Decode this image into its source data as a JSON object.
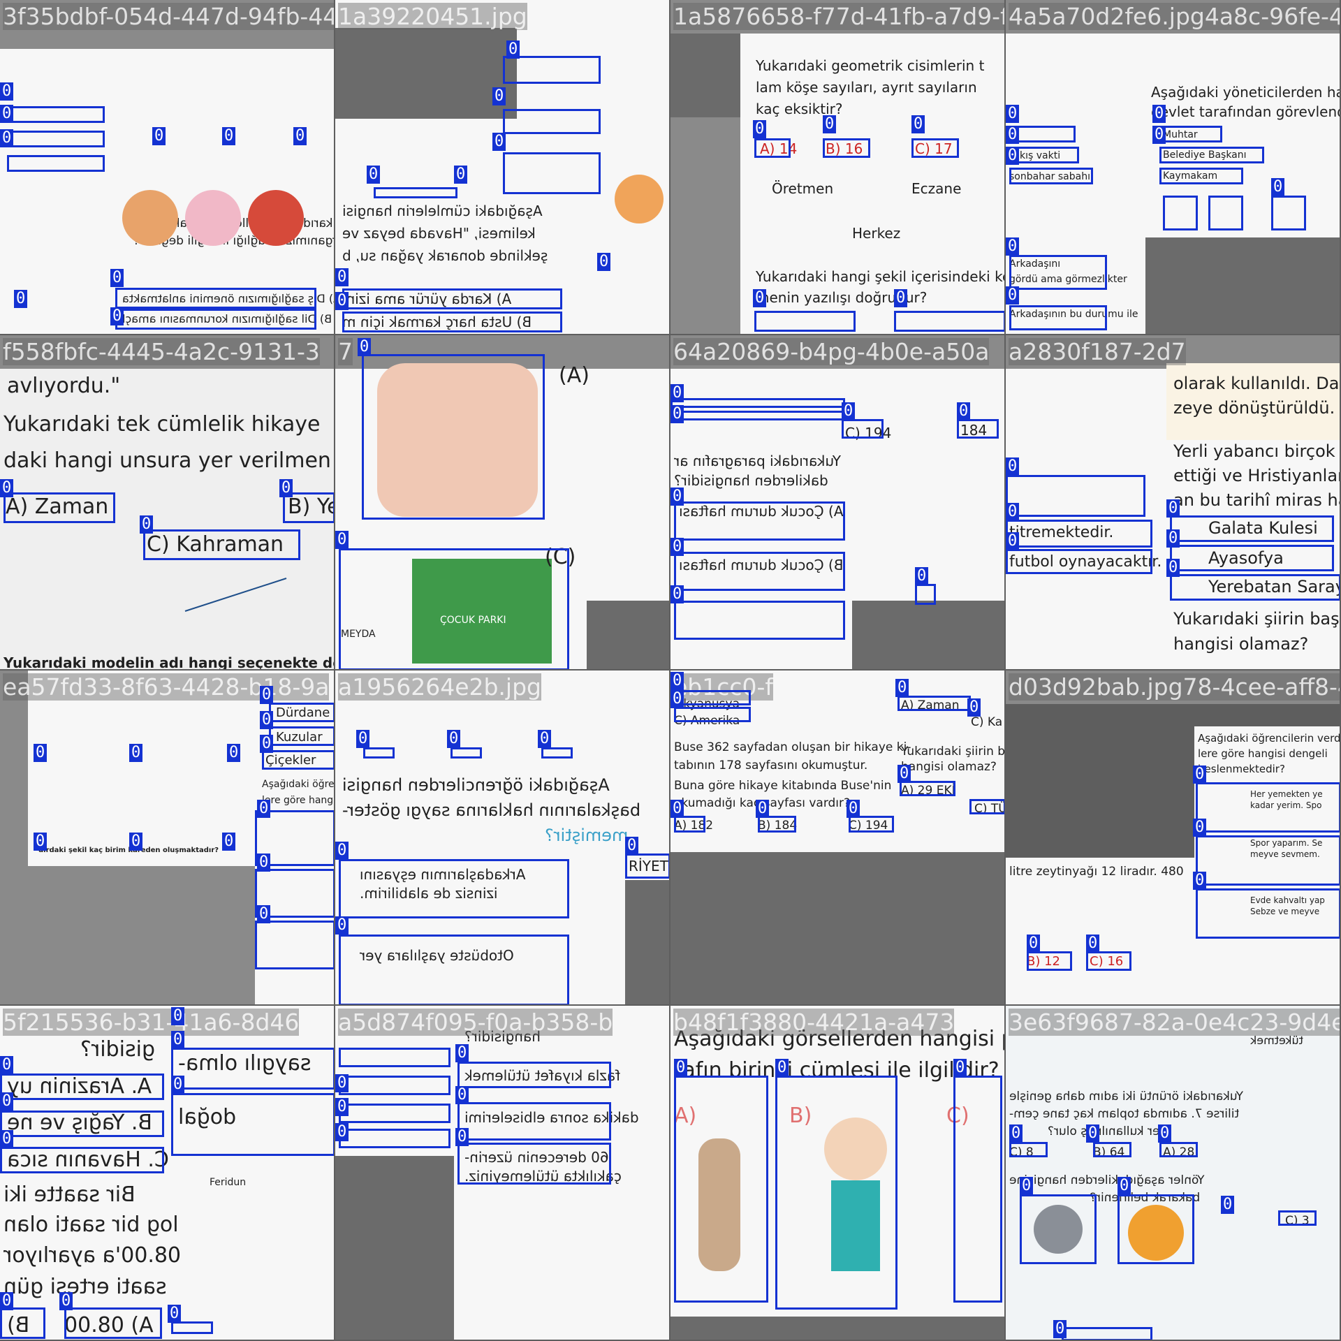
{
  "accent": "#1432d2",
  "box_label": "0",
  "tiles": [
    {
      "header": "3f35bdbf-054d-447d-94fb-44",
      "lines": [
        "Yukarıdaki görseller aşağıdaki hangi",
        "organımızın sağlığı ile ilgili değildir?",
        "A) Dış sağlığımızın önemini anlatmakta",
        "B) Dil sağlığımızın korunmasını amaçl"
      ]
    },
    {
      "header": "1a39220451.jpg",
      "lines": [
        "Aşağıdaki cümlelerin hangisi",
        "kelimesi, \"Havada beyaz ve",
        "şeklinde donarak yağan su, b",
        "A) Karda yürür ama izini",
        "B) Usta harç karmak için m"
      ]
    },
    {
      "header": "1a5876658-f77d-41fb-a7d9-f",
      "lines": [
        "Yukarıdaki geometrik cisimlerin t",
        "lam köşe sayıları, ayrıt sayıların",
        "kaç eksiktir?",
        "A) 14",
        "B) 16",
        "C) 17",
        "Öretmen",
        "Eczane",
        "Herkez",
        "Yukarıdaki hangi şekil içerisindeki keli",
        "menin yazılışı doğrudur?"
      ]
    },
    {
      "header": "4a5a70d2fe6.jpg4a8c-96fe-4",
      "lines": [
        "Aşağıdaki yöneticilerden hangis",
        "devlet tarafından görevlendirilir?",
        "Muhtar",
        "Belediye Başkanı",
        "Kaymakam",
        "kış vakti",
        "sonbahar sabahı",
        "Arkadaşını",
        "gördü ama görmezlikter",
        "Arkadaşının bu durumu ile"
      ]
    },
    {
      "header": "f558fbfc-4445-4a2c-9131-3",
      "lines": [
        "avlıyordu.\"",
        "Yukarıdaki tek cümlelik hikaye",
        "daki hangi unsura yer verilmen",
        "A) Zaman",
        "B) Ye",
        "C) Kahraman",
        "Yukarıdaki modelin adı hangi seçenekte doğ"
      ]
    },
    {
      "header": "7",
      "lines": [
        "(A)",
        "(C)",
        "ÇOCUK PARKI",
        "MEYDA"
      ]
    },
    {
      "header": "64a20869-b4pg-4b0e-a50a",
      "lines": [
        "Yukarıdaki paragrafın ar",
        "dakilerden hangisidir?",
        "A) Çocuk durum haftası",
        "B) Çocuk durum haftası",
        "C) 194",
        "184"
      ]
    },
    {
      "header": "a2830f187-2d7",
      "lines": [
        "olarak kullanıldı. Da",
        "zeye dönüştürüldü.",
        "Yerli yabancı birçok",
        "ettiği ve Hristiyanlar",
        "an bu tarihî miras ha",
        "Galata Kulesi",
        "Ayasofya",
        "Yerebatan Saray",
        "Yukarıdaki şiirin başlığ",
        "hangisi olamaz?",
        "titremektedir.",
        "futbol oynayacaktır."
      ]
    },
    {
      "header": "ea57fd33-8f63-4428-b18-9a",
      "lines": [
        "Dürdane",
        "Kuzular",
        "Çiçekler",
        "Aşağıdaki öğre",
        "lere göre hang",
        "dirdaki şekil kaç birim kareden oluşmaktadır?"
      ]
    },
    {
      "header": "a1956264e2b.jpg",
      "lines": [
        "Aşağıdaki öğrencilerden hangisi",
        "başkalarının haklarına saygı göster-",
        "memiştir?",
        "Arkadaşlarımın eşyasını",
        "izinsiz de alabilirim.",
        "Otobüste yaşlılara yer",
        "RİYET"
      ]
    },
    {
      "header": "eb1cc0-f",
      "lines": [
        "Okyanusya",
        "C) Amerika",
        "Buse 362 sayfadan oluşan bir hikaye ki-",
        "tabının 178 sayfasını okumuştur.",
        "Buna göre hikaye kitabında Buse'nin",
        "okumadığı kaç sayfası vardır?",
        "A) 182",
        "B) 184",
        "C) 194",
        "A) Zaman",
        "C) Ka",
        "Yukarıdaki şiirin ba",
        "hangisi olamaz?",
        "A) 29 EKİ",
        "C) TÜRK"
      ]
    },
    {
      "header": "d03d92bab.jpg78-4cee-aff8-46",
      "lines": [
        "Aşağıdaki öğrencilerin verdiğ",
        "lere göre hangisi dengeli",
        "beslenmektedir?",
        "Her yemekten ye",
        "kadar yerim. Spo",
        "Spor yaparım. Se",
        "meyve sevmem.",
        "Evde kahvaltı yap",
        "Sebze ve meyve",
        "litre zeytinyağı 12 liradır. 480",
        "B) 12",
        "C) 16"
      ]
    },
    {
      "header": "5f215536-b31-41a6-8d46",
      "lines": [
        "gisidir?",
        "A. Arazinin uy",
        "B. Yağış ve ne",
        "C. Havanın sıca",
        "Bir saatte iki",
        "log bir saati olan",
        "08.00'a ayarlıyor",
        "saati ertesi gün",
        "A) 08.00",
        "B)",
        "saygılı olma-",
        "doğal",
        "Feridun"
      ]
    },
    {
      "header": "a5d874f095-f0a-b358-b",
      "lines": [
        "hangisidir?",
        "fazla kıyafet ütülemek",
        "dakika sonra elbiselerimi",
        "60 derecenin üzerin-",
        "çakılıkta ütülemeyiniz."
      ]
    },
    {
      "header": "b48f1f3880-4421a-a473",
      "lines": [
        "Aşağıdaki görsellerden hangisi p",
        "rafın birinci cümlesi ile ilgilidir?",
        "A)",
        "B)",
        "C)"
      ]
    },
    {
      "header": "3e63f9687-82a-0e4c23-9d4e",
      "lines": [
        "Yukarıdaki örüntü iki adım daha genişle",
        "tilirse 7. adımda toplam kaç tane çem-",
        "ber kullanılmış olur?",
        "A) 28",
        "B) 64",
        "C) 8",
        "Yönler aşağıdakilerden hangisine",
        "bakarak belirlenir?",
        "C) 3",
        "tüketmek"
      ]
    }
  ]
}
